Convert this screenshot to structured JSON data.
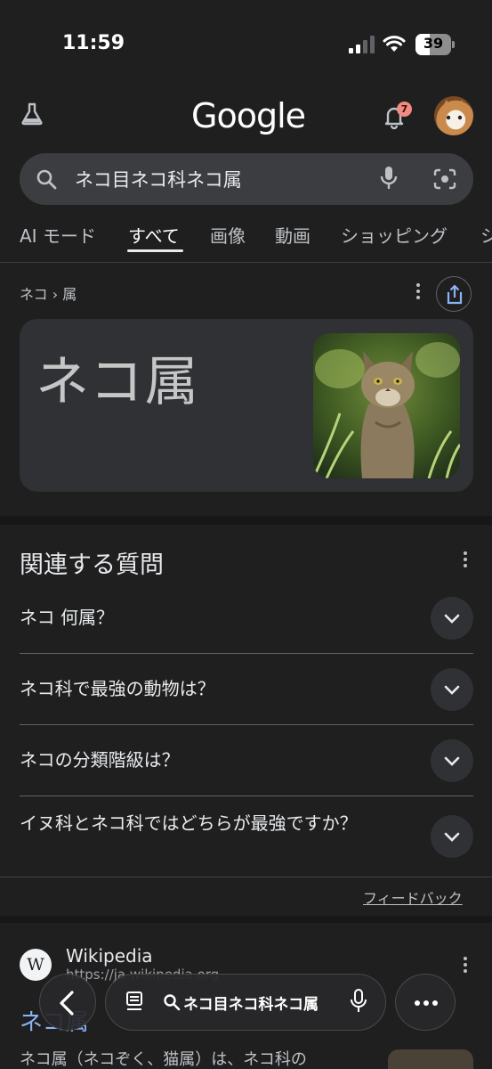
{
  "status_bar": {
    "time": "11:59",
    "battery": "39"
  },
  "header": {
    "logo": "Google",
    "notification_count": "7"
  },
  "search": {
    "query": "ネコ目ネコ科ネコ属"
  },
  "tabs": [
    {
      "label": "AI モード"
    },
    {
      "label": "すべて"
    },
    {
      "label": "画像"
    },
    {
      "label": "動画"
    },
    {
      "label": "ショッピング"
    },
    {
      "label": "シ"
    }
  ],
  "breadcrumb": "ネコ › 属",
  "knowledge_card": {
    "title": "ネコ属"
  },
  "people_also_ask": {
    "title": "関連する質問",
    "questions": [
      "ネコ 何属？",
      "ネコ科で最強の動物は？",
      "ネコの分類階級は？",
      "イヌ科とネコ科ではどちらが最強ですか？"
    ],
    "feedback": "フィードバック"
  },
  "result": {
    "site_name": "Wikipedia",
    "url": "https://ja.wikipedia.org",
    "title": "ネコ属",
    "snippet": "ネコ属（ネコぞく、猫属）は、ネコ科の"
  },
  "bottom_bar": {
    "query": "ネコ目ネコ科ネコ属"
  },
  "colors": {
    "background": "#1f1f1f",
    "link": "#8ab4f8",
    "badge": "#f28b82"
  }
}
